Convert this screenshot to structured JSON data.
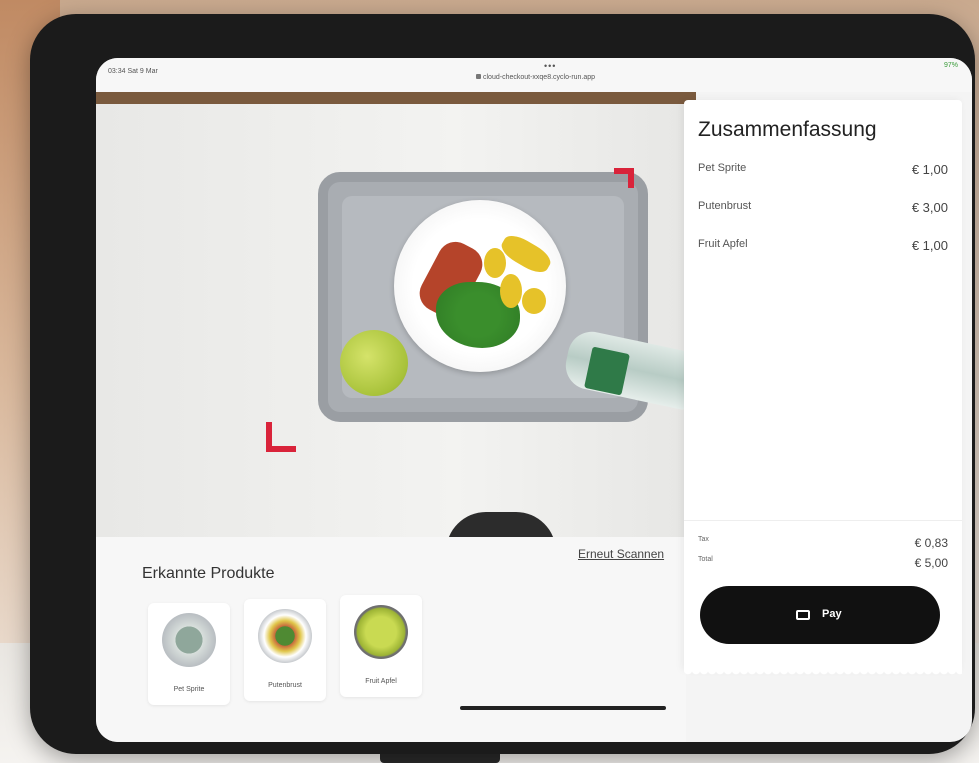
{
  "status_bar": {
    "time": "03:34  Sat 9 Mar",
    "url": "cloud-checkout-xxqe8.cyclo-run.app",
    "dots": "•••",
    "battery": "97%"
  },
  "products_panel": {
    "title": "Erkannte Produkte",
    "rescan_label": "Erneut Scannen",
    "items": [
      {
        "name": "Pet Sprite",
        "icon": "bottle-thumbnail"
      },
      {
        "name": "Putenbrust",
        "icon": "plate-thumbnail"
      },
      {
        "name": "Fruit Apfel",
        "icon": "apple-thumbnail"
      }
    ]
  },
  "summary": {
    "title": "Zusammenfassung",
    "items": [
      {
        "name": "Pet Sprite",
        "price": "€ 1,00"
      },
      {
        "name": "Putenbrust",
        "price": "€ 3,00"
      },
      {
        "name": "Fruit Apfel",
        "price": "€ 1,00"
      }
    ],
    "tax_label": "Tax",
    "tax_value": "€ 0,83",
    "total_label": "Total",
    "total_value": "€ 5,00",
    "pay_label": "Pay"
  },
  "colors": {
    "accent_marker": "#d9233a",
    "pay_button": "#111111"
  }
}
